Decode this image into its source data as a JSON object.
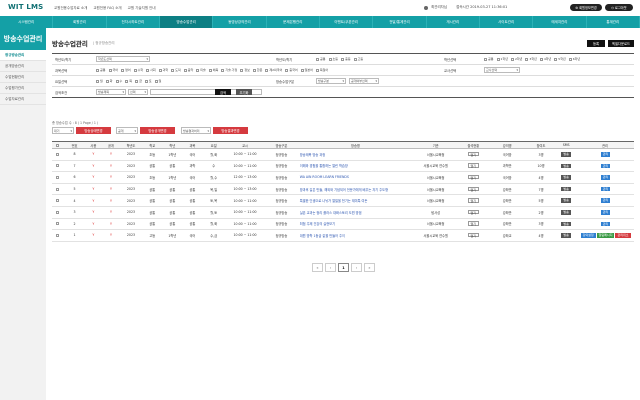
{
  "header": {
    "logo": "WIT LMS",
    "links": [
      "교원전용수업자료 소개",
      "교원전용 FAQ 소개",
      "교원 기술지원 안내"
    ],
    "user": "최관리자님",
    "session": "접속시간 2019-03-27 11:36:01",
    "mypage_label": "회원정보변경",
    "logout_label": "로그아웃"
  },
  "nav": [
    "시스템관리",
    "회원관리",
    "전자시하트관리",
    "방송수업관리",
    "동영상강의관리",
    "문제은행관리",
    "이벤트/쿠폰관리",
    "전달/통계관리",
    "게시관리",
    "사이트관리",
    "메세지관리",
    "통계관리"
  ],
  "nav_active_index": 3,
  "sidebar": {
    "title": "방송수업관리",
    "items": [
      "정규방송관리",
      "공개방송관리",
      "수업현황관리",
      "수업평가관리",
      "수업자료관리"
    ],
    "active_index": 0
  },
  "page": {
    "title": "방송수업관리",
    "crumb": "정규방송관리",
    "register_label": "등록",
    "excel_label": "엑셀다운로드"
  },
  "filters": {
    "row1": {
      "label_a": "학년도/학기",
      "select_a": "학년도선택",
      "label_b": "학년도/학기",
      "checks_b": [
        "공통",
        "초등",
        "중등",
        "고등"
      ],
      "label_c": "학년선택",
      "checks_c": [
        "공통",
        "1학년",
        "2학년",
        "3학년",
        "4학년",
        "5학년",
        "6학년"
      ]
    },
    "row2": {
      "label_a": "과목선택",
      "checks_a": [
        "공통",
        "국어",
        "영어",
        "수학",
        "사회",
        "과학",
        "도덕",
        "음악",
        "미술",
        "체육",
        "기술·가정",
        "정보",
        "한문",
        "제2외국어",
        "중국어",
        "일본어",
        "독일어"
      ],
      "label_c": "교사선택",
      "select_c": "교사선택"
    },
    "row3": {
      "label_a": "요일선택",
      "checks_a": [
        "월",
        "화",
        "수",
        "목",
        "금",
        "토",
        "일"
      ],
      "label_b": "방송수업구분",
      "select_b1": "방송구분",
      "select_b2": "공개여부선택"
    },
    "row4": {
      "label_a": "검색조건",
      "select_a1": "방송제목",
      "select_a2": "선택",
      "search_label": "검색",
      "reset_label": "초기화"
    }
  },
  "count_text": "총 방송수업 수 : 8 ( 1 Page / 1 )",
  "actions": {
    "status_select": "대기",
    "status_btn": "방송상태변경",
    "open_select": "공개",
    "open_btn": "방송공개변경",
    "close_select": "방송결과처리",
    "close_btn": "방송결과변경"
  },
  "table": {
    "headers": [
      "",
      "번호",
      "사용",
      "공개",
      "학년도",
      "학교",
      "학년",
      "과목",
      "요일",
      "교시",
      "방송구분",
      "방송명",
      "기관",
      "출석현황",
      "강의명",
      "참여도",
      "SMS",
      "관리"
    ],
    "rows": [
      {
        "no": "8",
        "use": "Y",
        "open": "Y",
        "year": "2023",
        "school": "초등",
        "grade": "1학년",
        "subj": "국어",
        "day": "월,화",
        "time": "10:00 ~ 11:00",
        "kind": "정규방송",
        "title": "방송제목 방송 과정",
        "org": "서울시교육청",
        "att": "열기",
        "lec": "국어방",
        "part": "3명",
        "btns": [
          "관리"
        ]
      },
      {
        "no": "7",
        "use": "Y",
        "open": "Y",
        "year": "2023",
        "school": "공통",
        "grade": "공통",
        "subj": "과학",
        "day": "수",
        "time": "10:00 ~ 11:00",
        "kind": "정규방송",
        "title": "이해와 경험을 통합하는 열린 학습방",
        "org": "서울시교육 연수원",
        "att": "열기",
        "lec": "과학반",
        "part": "10명",
        "btns": [
          "관리"
        ]
      },
      {
        "no": "6",
        "use": "Y",
        "open": "Y",
        "year": "2023",
        "school": "초등",
        "grade": "1학년",
        "subj": "국어",
        "day": "월,수",
        "time": "12:00 ~ 13:00",
        "kind": "정규방송",
        "title": "WA AIN ROOM LEARN FRIENDS",
        "org": "서울시교육청",
        "att": "열기",
        "lec": "국어방",
        "part": "4명",
        "btns": [
          "관리"
        ]
      },
      {
        "no": "5",
        "use": "Y",
        "open": "Y",
        "year": "2023",
        "school": "공통",
        "grade": "공통",
        "subj": "공통",
        "day": "목,일",
        "time": "10:00 ~ 13:00",
        "kind": "정규방송",
        "title": "방과후 길은 만들, 해외와 기념되어 전문가에게 배우는 자기 주도형",
        "org": "서울시교육청",
        "att": "열기",
        "lec": "강좌반",
        "part": "7명",
        "btns": [
          "관리"
        ]
      },
      {
        "no": "4",
        "use": "Y",
        "open": "Y",
        "year": "2023",
        "school": "공통",
        "grade": "공통",
        "subj": "공통",
        "day": "토,목",
        "time": "10:00 ~ 11:00",
        "kind": "정규방송",
        "title": "특별한 인생으로 나뉘가 열릴을 천기는 재미특 여든",
        "org": "서울시교육청",
        "att": "열기",
        "lec": "강좌반",
        "part": "5명",
        "btns": [
          "관리"
        ]
      },
      {
        "no": "3",
        "use": "Y",
        "open": "Y",
        "year": "2023",
        "school": "공통",
        "grade": "공통",
        "subj": "공통",
        "day": "월,토",
        "time": "10:00 ~ 11:00",
        "kind": "정규방송",
        "title": "실존 교과는 정리 플라스 대화스토리 도원 방범",
        "org": "탐사성",
        "att": "열기",
        "lec": "강좌반",
        "part": "2명",
        "btns": [
          "관리"
        ]
      },
      {
        "no": "2",
        "use": "Y",
        "open": "Y",
        "year": "2023",
        "school": "공통",
        "grade": "공통",
        "subj": "공통",
        "day": "월,화",
        "time": "10:00 ~ 11:00",
        "kind": "정규방송",
        "title": "최첨 주제 건강의 실현보기",
        "org": "서울시교육청",
        "att": "열기",
        "lec": "강좌반",
        "part": "3명",
        "btns": [
          "관리"
        ]
      },
      {
        "no": "1",
        "use": "Y",
        "open": "Y",
        "year": "2023",
        "school": "고등",
        "grade": "1학년",
        "subj": "국어",
        "day": "수,금",
        "time": "10:00 ~ 11:00",
        "kind": "정규방송",
        "title": "대원 방학 1등급 같을 만들어 주이",
        "org": "서울시교육 연수원",
        "att": "열기",
        "lec": "강좌교",
        "part": "4명",
        "btns": [
          "강의설정",
          "알림메시지",
          "관리취소"
        ]
      }
    ]
  },
  "pagination": [
    "«",
    "‹",
    "1",
    "›",
    "»"
  ],
  "colors": {
    "teal": "#14a0a6",
    "teal_dark": "#0d7f84",
    "red": "#d53a3f",
    "link": "#2b55b0"
  }
}
